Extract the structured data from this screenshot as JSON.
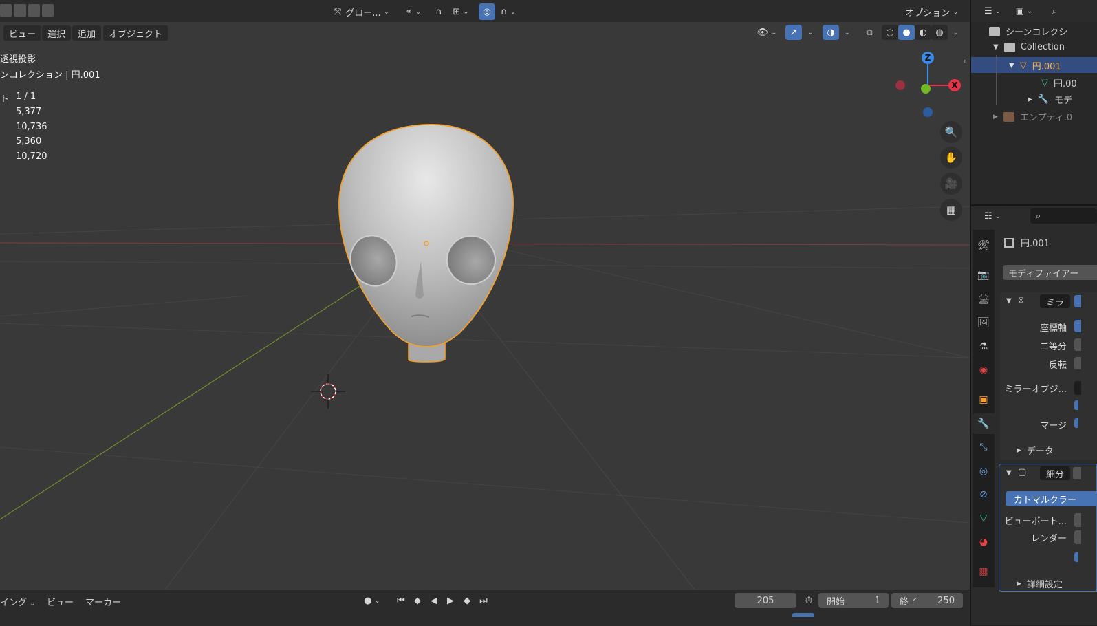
{
  "header": {
    "transform_orientation": "グロー...",
    "options": "オプション"
  },
  "viewport_menu": [
    "ビュー",
    "選択",
    "追加",
    "オブジェクト"
  ],
  "overlay": {
    "view_mode": "透視投影",
    "collection_line": "ンコレクション | 円.001",
    "stats": [
      {
        "label": "ト",
        "value": "1 / 1"
      },
      {
        "label": "",
        "value": "5,377"
      },
      {
        "label": "",
        "value": "10,736"
      },
      {
        "label": "",
        "value": "5,360"
      },
      {
        "label": "",
        "value": "10,720"
      }
    ]
  },
  "gizmo": {
    "x": "X",
    "y": "",
    "z": "Z"
  },
  "timeline": {
    "menu": [
      "イング",
      "ビュー",
      "マーカー"
    ],
    "current_frame": "205",
    "start_label": "開始",
    "start_value": "1",
    "end_label": "終了",
    "end_value": "250"
  },
  "outliner": {
    "scene_collection": "シーンコレクシ",
    "collection": "Collection",
    "object": "円.001",
    "mesh_data": "円.00",
    "modifiers": "モデ",
    "empty": "エンプティ.0"
  },
  "properties": {
    "object_name": "円.001",
    "add_modifier": "モディファイアー",
    "mirror": {
      "name": "ミラ",
      "axis_label": "座標軸",
      "bisect_label": "二等分",
      "flip_label": "反転",
      "mirror_object_label": "ミラーオブジ...",
      "merge_label": "マージ",
      "data_label": "データ"
    },
    "subdivision": {
      "name": "細分",
      "method": "カトマルクラー",
      "viewport_label": "ビューポート...",
      "render_label": "レンダー",
      "advanced_label": "詳細設定"
    }
  },
  "colors": {
    "accent": "#4772b3",
    "selection": "#ff9d2b",
    "x_axis": "#e5344a",
    "y_axis": "#71b824",
    "z_axis": "#3c8be5"
  }
}
